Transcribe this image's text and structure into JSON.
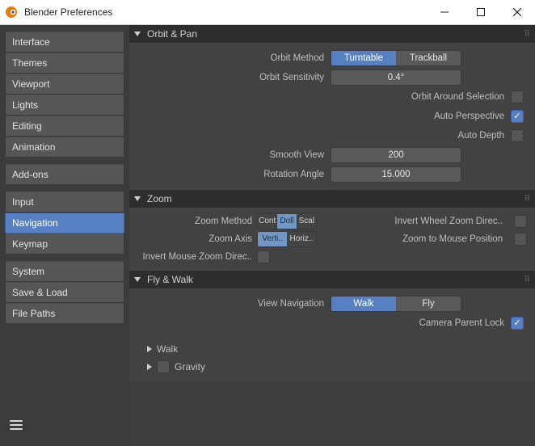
{
  "window": {
    "title": "Blender Preferences"
  },
  "sidebar": {
    "groups": [
      [
        "Interface",
        "Themes",
        "Viewport",
        "Lights",
        "Editing",
        "Animation"
      ],
      [
        "Add-ons"
      ],
      [
        "Input",
        "Navigation",
        "Keymap"
      ],
      [
        "System",
        "Save & Load",
        "File Paths"
      ]
    ],
    "active": "Navigation"
  },
  "sections": {
    "orbit": {
      "title": "Orbit & Pan",
      "orbit_method_label": "Orbit Method",
      "orbit_method_options": [
        "Turntable",
        "Trackball"
      ],
      "orbit_method_value": "Turntable",
      "orbit_sensitivity_label": "Orbit Sensitivity",
      "orbit_sensitivity_value": "0.4°",
      "orbit_around_sel_label": "Orbit Around Selection",
      "orbit_around_sel_value": false,
      "auto_perspective_label": "Auto Perspective",
      "auto_perspective_value": true,
      "auto_depth_label": "Auto Depth",
      "auto_depth_value": false,
      "smooth_view_label": "Smooth View",
      "smooth_view_value": "200",
      "rotation_angle_label": "Rotation Angle",
      "rotation_angle_value": "15.000"
    },
    "zoom": {
      "title": "Zoom",
      "zoom_method_label": "Zoom Method",
      "zoom_method_options": [
        "Cont",
        "Doll",
        "Scal"
      ],
      "zoom_method_value": "Doll",
      "zoom_axis_label": "Zoom Axis",
      "zoom_axis_options": [
        "Verti..",
        "Horiz.."
      ],
      "zoom_axis_value": "Verti..",
      "invert_mouse_label": "Invert Mouse Zoom Direc..",
      "invert_mouse_value": false,
      "invert_wheel_label": "Invert Wheel Zoom Direc..",
      "invert_wheel_value": false,
      "zoom_to_mouse_label": "Zoom to Mouse Position",
      "zoom_to_mouse_value": false
    },
    "flywalk": {
      "title": "Fly & Walk",
      "view_nav_label": "View Navigation",
      "view_nav_options": [
        "Walk",
        "Fly"
      ],
      "view_nav_value": "Walk",
      "camera_parent_lock_label": "Camera Parent Lock",
      "camera_parent_lock_value": true,
      "sub_walk_label": "Walk",
      "sub_gravity_label": "Gravity",
      "sub_gravity_value": false
    }
  }
}
